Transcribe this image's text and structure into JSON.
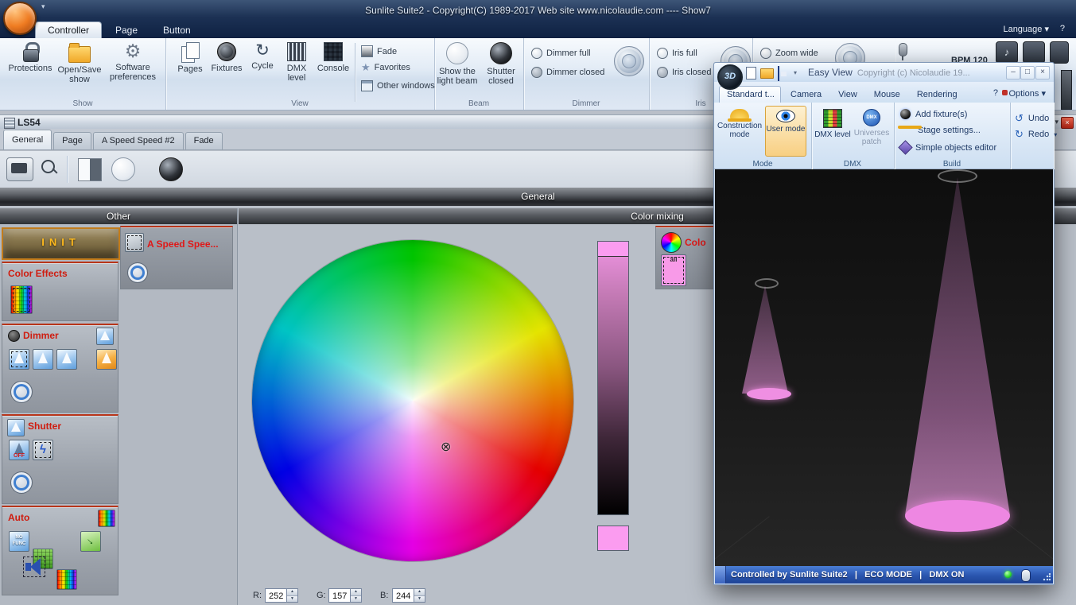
{
  "titlebar": {
    "title": "Sunlite Suite2 - Copyright(C) 1989-2017    Web site www.nicolaudie.com ---- Show7"
  },
  "apptabs": {
    "controller": "Controller",
    "page": "Page",
    "button": "Button",
    "language": "Language",
    "help": "?"
  },
  "ribbon": {
    "show": {
      "label": "Show",
      "protections": "Protections",
      "open_save": "Open/Save show",
      "software_prefs": "Software preferences"
    },
    "view": {
      "label": "View",
      "pages": "Pages",
      "fixtures": "Fixtures",
      "cycle": "Cycle",
      "dmx_level": "DMX level",
      "console": "Console",
      "fade": "Fade",
      "favorites": "Favorites",
      "other_windows": "Other windows"
    },
    "beam": {
      "label": "Beam",
      "show_beam": "Show the light beam",
      "shutter_closed": "Shutter closed"
    },
    "dimmer": {
      "label": "Dimmer",
      "full": "Dimmer full",
      "closed": "Dimmer closed"
    },
    "iris": {
      "label": "Iris",
      "full": "Iris full",
      "closed": "Iris closed"
    },
    "zoom": {
      "wide": "Zoom wide"
    },
    "bpm": "BPM 120"
  },
  "ls54": {
    "title": "LS54",
    "tabs": [
      "General",
      "Page",
      "A Speed Speed #2",
      "Fade"
    ],
    "header": "General"
  },
  "left": {
    "header": "Other",
    "init": "INIT",
    "color_effects": "Color Effects",
    "dimmer": "Dimmer",
    "shutter": "Shutter",
    "off": "OFF",
    "auto": "Auto",
    "no_func": "NO FUNC"
  },
  "mix": {
    "header": "Color mixing",
    "speed_button": "A Speed Spee...",
    "color_button": "Colo",
    "color_all": "all",
    "r_label": "R:",
    "r": "252",
    "g_label": "G:",
    "g": "157",
    "b_label": "B:",
    "b": "244",
    "selected_color": "#fb9cf0",
    "slider_top_color": "#fb9cf0"
  },
  "easyview": {
    "logo": "3D",
    "title": "Easy View",
    "subtitle": "Copyright (c) Nicolaudie 19...",
    "tabs": [
      "Standard t...",
      "Camera",
      "View",
      "Mouse",
      "Rendering"
    ],
    "help": "?",
    "options": "Options",
    "mode_label": "Mode",
    "construction": "Construction mode",
    "user": "User mode",
    "dmx_label": "DMX",
    "dmx_level": "DMX level",
    "universes": "Universes patch",
    "build_label": "Build",
    "add_fixture": "Add fixture(s)",
    "stage_settings": "Stage settings...",
    "objects_editor": "Simple objects editor",
    "undo": "Undo",
    "redo": "Redo",
    "status": "Controlled by Sunlite Suite2   |   ECO MODE   |   DMX ON"
  },
  "icons": {
    "chevron_down": "▾",
    "gear": "⚙",
    "cycle_arrow": "↻",
    "star": "★",
    "lightning": "ϟ",
    "cursor_cross": "⊗",
    "undo_arrow": "↺",
    "redo_arrow": "↻",
    "minimize": "–",
    "maximize": "□",
    "close": "×",
    "note": "♪",
    "arrow": "→"
  }
}
